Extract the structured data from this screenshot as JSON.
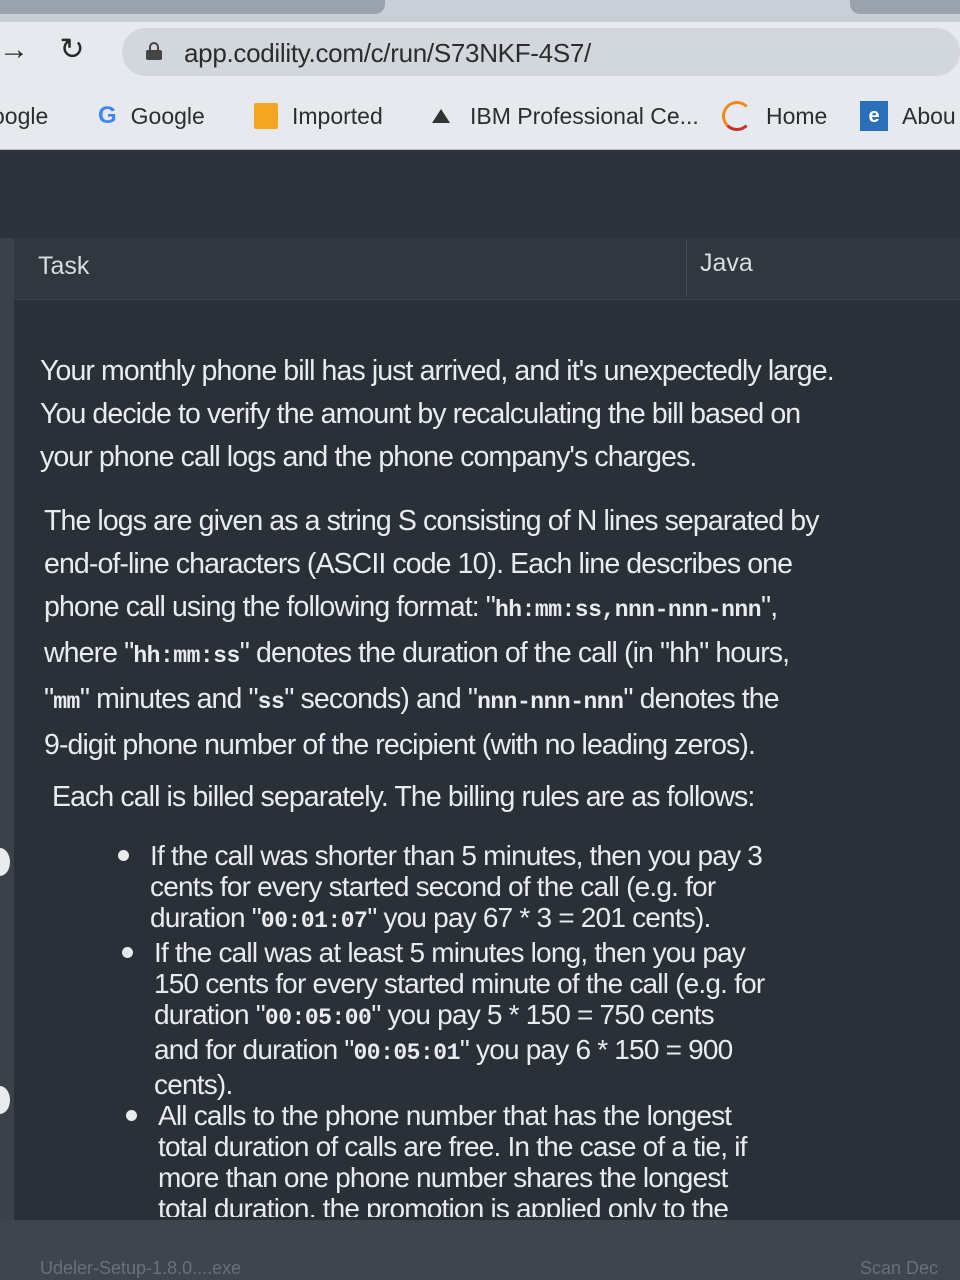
{
  "browser": {
    "url": "app.codility.com/c/run/S73NKF-4S7/",
    "bookmarks": [
      {
        "label": "oogle",
        "icon": "none"
      },
      {
        "label": "Google",
        "icon": "google-g-icon"
      },
      {
        "label": "Imported",
        "icon": "folder-icon"
      },
      {
        "label": "IBM Professional Ce...",
        "icon": "ibm-icon"
      },
      {
        "label": "Home",
        "icon": "home-icon"
      },
      {
        "label": "Abou",
        "icon": "about-icon"
      }
    ]
  },
  "task": {
    "tab_label": "Task",
    "language": "Java"
  },
  "description": {
    "para1_lines": [
      "Your monthly phone bill has just arrived, and it's unexpectedly large.",
      "You decide to verify the amount by recalculating the bill based on",
      "your phone call logs and the phone company's charges."
    ],
    "para2": {
      "l1": "The logs are given as a string S consisting of N lines separated by",
      "l2": "end-of-line characters (ASCII code 10). Each line describes one",
      "l3a": "phone call using the following format: \"",
      "l3code": "hh:mm:ss,nnn-nnn-nnn",
      "l3b": "\",",
      "l4a": "where \"",
      "l4code": "hh:mm:ss",
      "l4b": "\" denotes the duration of the call (in \"hh\" hours,",
      "l5a": "\"",
      "l5code1": "mm",
      "l5b": "\" minutes and \"",
      "l5code2": "ss",
      "l5c": "\" seconds) and \"",
      "l5code3": "nnn-nnn-nnn",
      "l5d": "\" denotes the",
      "l6": "9-digit phone number of the recipient (with no leading zeros)."
    },
    "para3": "Each call is billed separately. The billing rules are as follows:",
    "rules": {
      "r1_l1": "If the call was shorter than 5 minutes, then you pay 3",
      "r1_l2": "cents for every started second of the call (e.g. for",
      "r1_l3a": "duration \"",
      "r1_l3code": "00:01:07",
      "r1_l3b": "\" you pay 67 * 3 = 201 cents).",
      "r2_l1": "If the call was at least 5 minutes long, then you pay",
      "r2_l2": "150 cents for every started minute of the call (e.g. for",
      "r2_l3a": "duration \"",
      "r2_l3code": "00:05:00",
      "r2_l3b": "\" you pay 5 * 150 = 750 cents",
      "r2_l4a": "and for duration \"",
      "r2_l4code": "00:05:01",
      "r2_l4b": "\" you pay 6 * 150 = 900",
      "r2_l5": "cents).",
      "r3_l1": "All calls to the phone number that has the longest",
      "r3_l2": "total duration of calls are free. In the case of a tie, if",
      "r3_l3": "more than one phone number shares the longest",
      "r3_l4": "total duration, the promotion is applied only to the"
    }
  },
  "taskbar": {
    "item1": "Udeler-Setup-1.8.0....exe",
    "item2": "Scan Dec"
  }
}
